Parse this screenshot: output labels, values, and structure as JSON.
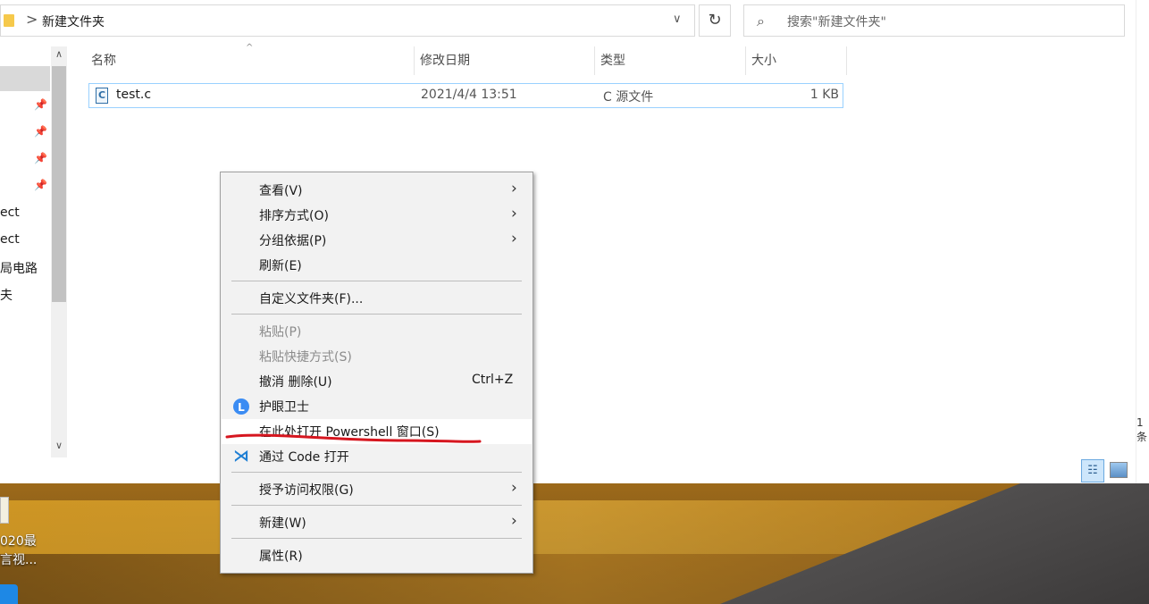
{
  "address_bar": {
    "path_segment": "新建文件夹",
    "separator": ">",
    "dropdown": "∨"
  },
  "search": {
    "placeholder": "搜索\"新建文件夹\""
  },
  "nav": {
    "labels": [
      "ect",
      "ect",
      "局电路",
      "夫"
    ]
  },
  "columns": {
    "name": "名称",
    "date": "修改日期",
    "type": "类型",
    "size": "大小"
  },
  "files": [
    {
      "icon_text": "C",
      "name": "test.c",
      "date": "2021/4/4 13:51",
      "type": "C 源文件",
      "size": "1 KB"
    }
  ],
  "context_menu": {
    "view": "查看(V)",
    "sort": "排序方式(O)",
    "group": "分组依据(P)",
    "refresh": "刷新(E)",
    "customize": "自定义文件夹(F)...",
    "paste": "粘贴(P)",
    "paste_shortcut": "粘贴快捷方式(S)",
    "undo": "撤消 删除(U)",
    "undo_shortcut": "Ctrl+Z",
    "eye_guard": "护眼卫士",
    "eye_guard_icon": "L",
    "powershell": "在此处打开 Powershell 窗口(S)",
    "vscode": "通过 Code 打开",
    "vscode_icon": "⋊",
    "grant_access": "授予访问权限(G)",
    "new": "新建(W)",
    "properties": "属性(R)"
  },
  "desktop": {
    "text_line1": "020最",
    "text_line2": "言视..."
  },
  "right_edge_text": "1 条",
  "colors": {
    "selection_border": "#99d1ff",
    "annotation": "#d6161f",
    "menu_bg": "#f2f2f2"
  }
}
